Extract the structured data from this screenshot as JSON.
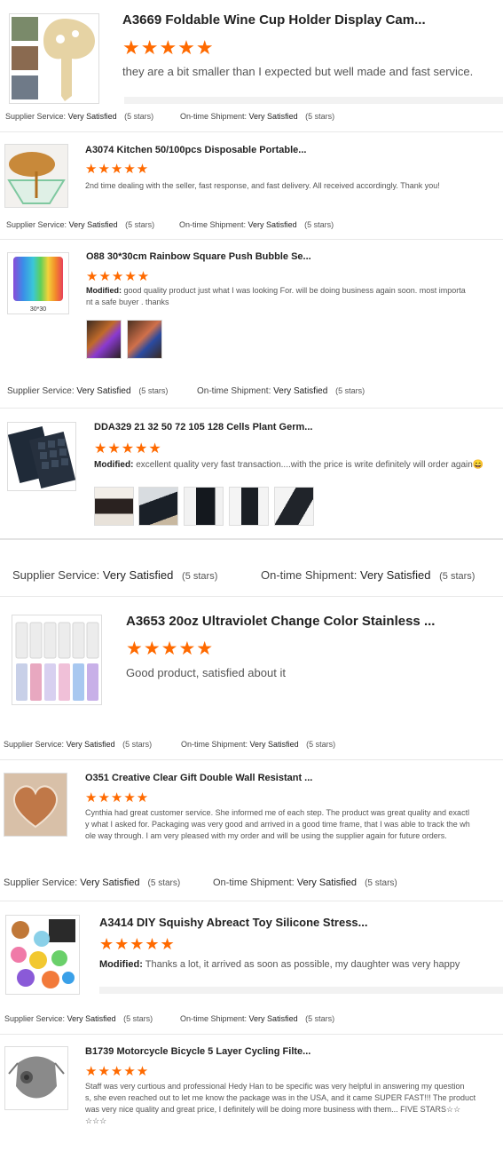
{
  "reviews": [
    {
      "title": "A3669 Foldable Wine Cup Holder Display Cam...",
      "stars": "★★★★★",
      "text": "they are a bit smaller than I expected but well made and fast service.",
      "supplier_label": "Supplier Service:",
      "supplier_value": "Very Satisfied",
      "supplier_stars": "(5 stars)",
      "shipment_label": "On-time Shipment:",
      "shipment_value": "Very Satisfied",
      "shipment_stars": "(5 stars)"
    },
    {
      "title": "A3074 Kitchen 50/100pcs Disposable Portable...",
      "stars": "★★★★★",
      "text": "2nd time dealing with the seller, fast response, and fast delivery. All received accordingly. Thank you!",
      "supplier_label": "Supplier Service:",
      "supplier_value": "Very Satisfied",
      "supplier_stars": "(5 stars)",
      "shipment_label": "On-time Shipment:",
      "shipment_value": "Very Satisfied",
      "shipment_stars": "(5 stars)"
    },
    {
      "title": "O88 30*30cm Rainbow Square Push Bubble Se...",
      "stars": "★★★★★",
      "modified": "Modified:",
      "text_l1": "good quality product just what I was looking For. will be doing business again soon. most importa",
      "text_l2": "nt a safe buyer . thanks",
      "thumb_caption": "30*30",
      "supplier_label": "Supplier Service:",
      "supplier_value": "Very Satisfied",
      "supplier_stars": "(5 stars)",
      "shipment_label": "On-time Shipment:",
      "shipment_value": "Very Satisfied",
      "shipment_stars": "(5 stars)"
    },
    {
      "title": "DDA329 21 32 50 72 105 128 Cells Plant Germ...",
      "stars": "★★★★★",
      "modified": "Modified:",
      "text": "excellent quality very fast transaction....with the price is write definitely will order again",
      "emoji": "😄",
      "supplier_label": "Supplier Service:",
      "supplier_value": "Very Satisfied",
      "supplier_stars": "(5 stars)",
      "shipment_label": "On-time Shipment:",
      "shipment_value": "Very Satisfied",
      "shipment_stars": "(5 stars)"
    },
    {
      "title": "A3653 20oz Ultraviolet Change Color Stainless ...",
      "stars": "★★★★★",
      "text": "Good product, satisfied about it",
      "supplier_label": "Supplier Service:",
      "supplier_value": "Very Satisfied",
      "supplier_stars": "(5 stars)",
      "shipment_label": "On-time Shipment:",
      "shipment_value": "Very Satisfied",
      "shipment_stars": "(5 stars)"
    },
    {
      "title": "O351 Creative Clear Gift Double Wall Resistant ...",
      "stars": "★★★★★",
      "text_l1": "Cynthia had great customer service. She informed me of each step. The product was great quality and exactl",
      "text_l2": "y what I asked for. Packaging was very good and arrived in a good time frame, that I was able to track the wh",
      "text_l3": "ole way through. I am very pleased with my order and will be using the supplier again for future orders.",
      "supplier_label": "Supplier Service:",
      "supplier_value": "Very Satisfied",
      "supplier_stars": "(5 stars)",
      "shipment_label": "On-time Shipment:",
      "shipment_value": "Very Satisfied",
      "shipment_stars": "(5 stars)"
    },
    {
      "title": "A3414 DIY Squishy Abreact Toy Silicone Stress...",
      "stars": "★★★★★",
      "modified": "Modified:",
      "text": "Thanks a lot, it arrived as soon as possible, my daughter was very happy",
      "supplier_label": "Supplier Service:",
      "supplier_value": "Very Satisfied",
      "supplier_stars": "(5 stars)",
      "shipment_label": "On-time Shipment:",
      "shipment_value": "Very Satisfied",
      "shipment_stars": "(5 stars)"
    },
    {
      "title": "B1739 Motorcycle Bicycle 5 Layer Cycling Filte...",
      "stars": "★★★★★",
      "text_l1": "Staff was very curtious and professional Hedy Han to be specific was very helpful in answering my question",
      "text_l2": "s, she even reached out to let me know the package was in the USA, and it came SUPER FAST!!! The product",
      "text_l3": "was very nice quality and great price, I definitely will be doing more business with them... FIVE STARS☆☆",
      "text_l4": "☆☆☆"
    }
  ]
}
